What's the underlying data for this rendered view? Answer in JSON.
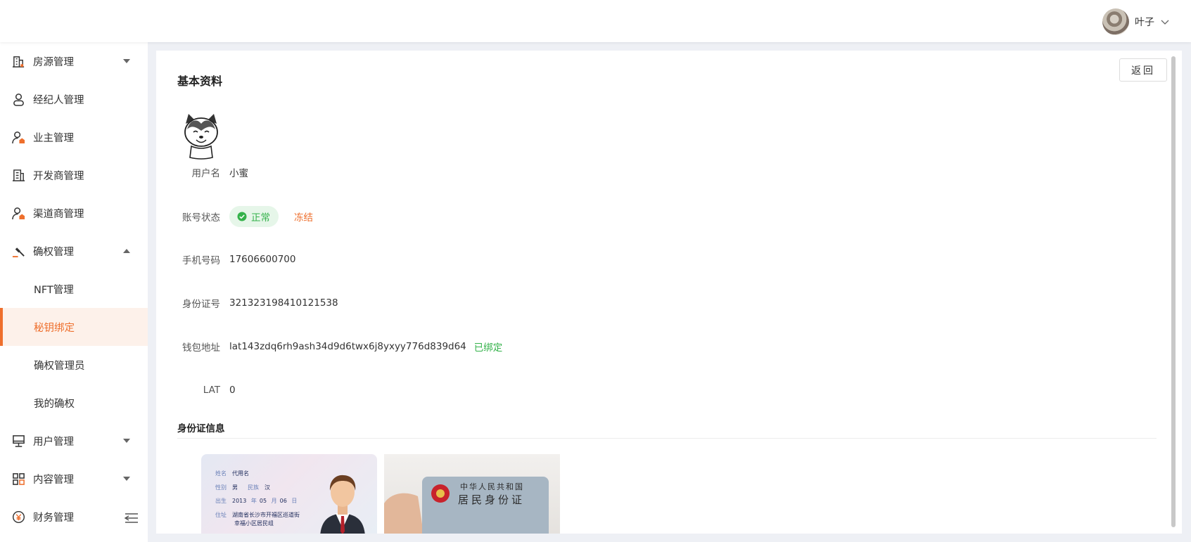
{
  "header": {
    "user_name": "叶子"
  },
  "sidebar": {
    "items": [
      {
        "label": "房源管理",
        "icon": "building-icon"
      },
      {
        "label": "经纪人管理",
        "icon": "person-icon"
      },
      {
        "label": "业主管理",
        "icon": "owner-icon"
      },
      {
        "label": "开发商管理",
        "icon": "office-icon"
      },
      {
        "label": "渠道商管理",
        "icon": "channel-icon"
      },
      {
        "label": "确权管理",
        "icon": "gavel-icon"
      }
    ],
    "sub_items": [
      {
        "label": "NFT管理"
      },
      {
        "label": "秘钥绑定"
      },
      {
        "label": "确权管理员"
      },
      {
        "label": "我的确权"
      }
    ],
    "items_after": [
      {
        "label": "用户管理",
        "icon": "monitor-icon"
      },
      {
        "label": "内容管理",
        "icon": "grid-icon"
      },
      {
        "label": "财务管理",
        "icon": "yen-icon"
      }
    ]
  },
  "main": {
    "back_label": "返回",
    "section_title": "基本资料",
    "fields": {
      "username_label": "用户名",
      "username": "小蜜",
      "status_label": "账号状态",
      "status": "正常",
      "freeze_label": "冻结",
      "phone_label": "手机号码",
      "phone": "17606600700",
      "idnum_label": "身份证号",
      "idnum": "321323198410121538",
      "wallet_label": "钱包地址",
      "wallet": "lat143zdq6rh9ash34d9d6twx6j8yxyy776d839d64",
      "wallet_status": "已绑定",
      "lat_label": "LAT",
      "lat": "0"
    },
    "id_section_title": "身份证信息",
    "id_front": {
      "name_key": "姓名",
      "name": "代用名",
      "sex_key": "性别",
      "sex": "男",
      "nation_key": "民族",
      "nation": "汉",
      "birth_key": "出生",
      "year": "2013",
      "year_unit": "年",
      "month": "05",
      "month_unit": "月",
      "day": "06",
      "day_unit": "日",
      "addr_key": "住址",
      "addr1": "湖南省长沙市开福区巡道街",
      "addr2": "幸福小区居民组"
    },
    "id_back": {
      "country": "中华人民共和国",
      "title": "居民身份证"
    }
  },
  "colors": {
    "accent": "#ee6f2d",
    "success": "#34b24a",
    "active_bg": "#fdf1ea"
  }
}
